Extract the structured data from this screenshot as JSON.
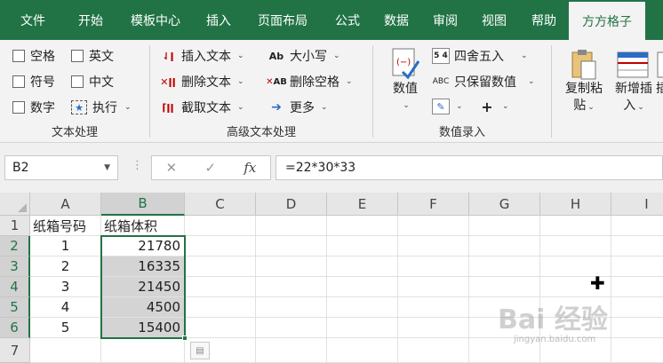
{
  "tabs": [
    "文件",
    "开始",
    "模板中心",
    "插入",
    "页面布局",
    "公式",
    "数据",
    "审阅",
    "视图",
    "帮助",
    "方方格子"
  ],
  "ribbon": {
    "text_group": {
      "items": [
        "空格",
        "英文",
        "符号",
        "中文",
        "数字",
        "执行"
      ],
      "label": "文本处理"
    },
    "adv_group": {
      "items": [
        "插入文本",
        "大小写",
        "删除文本",
        "删除空格",
        "截取文本",
        "更多"
      ],
      "label": "高级文本处理"
    },
    "num_group": {
      "value_btn": "数值",
      "items": [
        "四舍五入",
        "只保留数值"
      ],
      "label": "数值录入"
    },
    "tail": {
      "copy_l1": "复制粘",
      "copy_l2": "贴",
      "add_l1": "新增插",
      "add_l2": "入",
      "cut": "插"
    }
  },
  "formula_bar": {
    "name_box": "B2",
    "fx": "fx",
    "formula": "=22*30*33"
  },
  "sheet": {
    "columns": [
      "A",
      "B",
      "C",
      "D",
      "E",
      "F",
      "G",
      "H",
      "I"
    ],
    "rows": [
      "1",
      "2",
      "3",
      "4",
      "5",
      "6",
      "7"
    ],
    "a_cells": [
      "纸箱号码",
      "1",
      "2",
      "3",
      "4",
      "5"
    ],
    "b_cells": [
      "纸箱体积",
      "21780",
      "16335",
      "21450",
      "4500",
      "15400"
    ]
  },
  "watermark": {
    "brand": "Bai 经验",
    "url": "jingyan.baidu.com"
  }
}
